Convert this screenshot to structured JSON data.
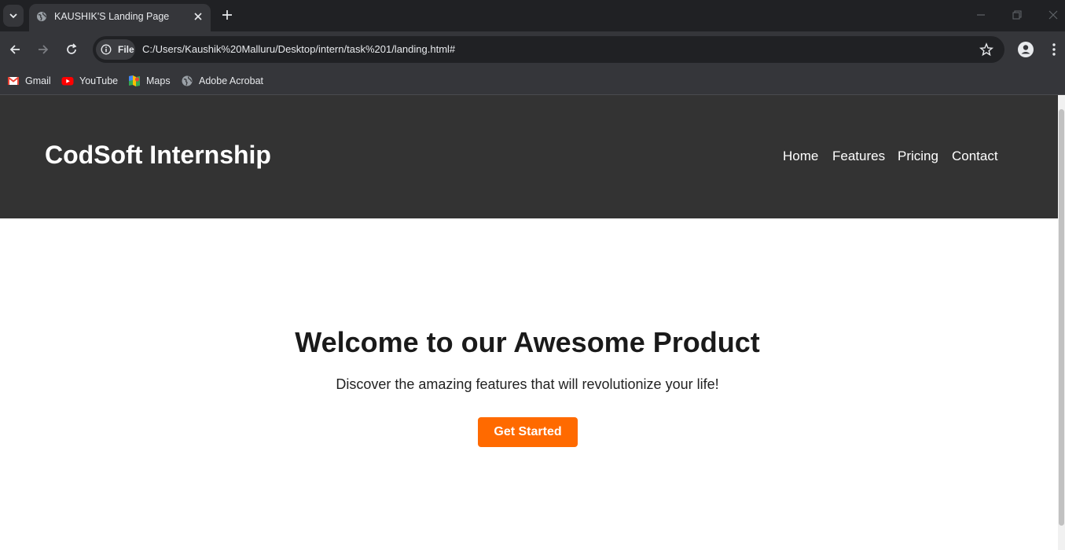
{
  "browser": {
    "tab": {
      "title": "KAUSHIK'S Landing Page",
      "favicon": "globe-icon"
    },
    "omnibox": {
      "scheme_chip": "File",
      "url": "C:/Users/Kaushik%20Malluru/Desktop/intern/task%201/landing.html#"
    },
    "bookmarks": [
      {
        "label": "Gmail",
        "icon": "gmail-icon"
      },
      {
        "label": "YouTube",
        "icon": "youtube-icon"
      },
      {
        "label": "Maps",
        "icon": "maps-icon"
      },
      {
        "label": "Adobe Acrobat",
        "icon": "globe-icon"
      }
    ]
  },
  "page": {
    "header": {
      "logo": "CodSoft Internship",
      "nav": [
        "Home",
        "Features",
        "Pricing",
        "Contact"
      ]
    },
    "hero": {
      "title": "Welcome to our Awesome Product",
      "subtitle": "Discover the amazing features that will revolutionize your life!",
      "cta_label": "Get Started"
    }
  },
  "colors": {
    "header_bg": "#333333",
    "cta_bg": "#ff6a00",
    "browser_frame": "#202124",
    "toolbar": "#35363a"
  }
}
